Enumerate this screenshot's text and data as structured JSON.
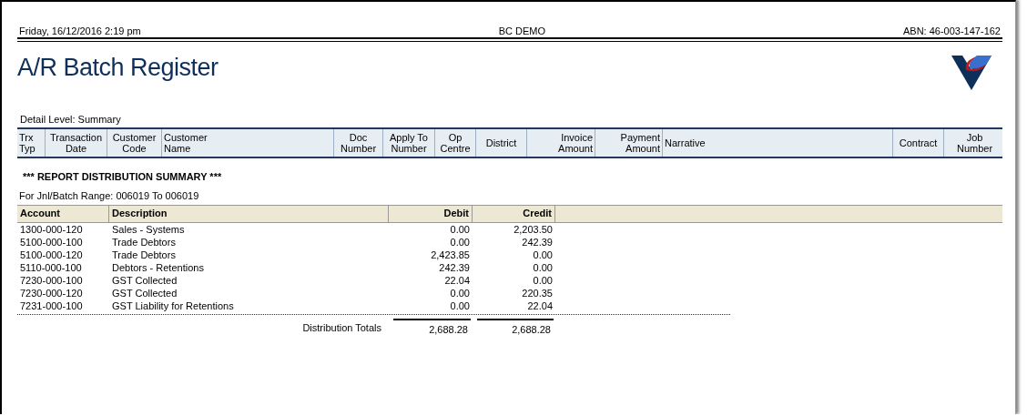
{
  "header": {
    "date": "Friday, 16/12/2016  2:19 pm",
    "company": "BC DEMO",
    "abn": "ABN: 46-003-147-162"
  },
  "title": "A/R Batch Register",
  "detail_level": "Detail Level: Summary",
  "columns": [
    {
      "lines": [
        "Trx",
        "Typ"
      ]
    },
    {
      "lines": [
        "Transaction",
        "Date"
      ]
    },
    {
      "lines": [
        "Customer",
        "Code"
      ]
    },
    {
      "lines": [
        "Customer",
        "Name"
      ]
    },
    {
      "lines": [
        "Doc",
        "Number"
      ]
    },
    {
      "lines": [
        "Apply To",
        "Number"
      ]
    },
    {
      "lines": [
        "Op",
        "Centre"
      ]
    },
    {
      "lines": [
        "District"
      ]
    },
    {
      "lines": [
        "Invoice",
        "Amount"
      ]
    },
    {
      "lines": [
        "Payment",
        "Amount"
      ]
    },
    {
      "lines": [
        "Narrative"
      ]
    },
    {
      "lines": [
        "Contract"
      ]
    },
    {
      "lines": [
        "Job",
        "Number"
      ]
    }
  ],
  "summary": {
    "heading": "*** REPORT DISTRIBUTION SUMMARY ***",
    "range": "For Jnl/Batch Range: 006019 To 006019",
    "table": {
      "columns": [
        "Account",
        "Description",
        "Debit",
        "Credit"
      ],
      "rows": [
        [
          "1300-000-120",
          "Sales - Systems",
          "0.00",
          "2,203.50"
        ],
        [
          "5100-000-100",
          "Trade Debtors",
          "0.00",
          "242.39"
        ],
        [
          "5100-000-120",
          "Trade Debtors",
          "2,423.85",
          "0.00"
        ],
        [
          "5110-000-100",
          "Debtors - Retentions",
          "242.39",
          "0.00"
        ],
        [
          "7230-000-100",
          "GST Collected",
          "22.04",
          "0.00"
        ],
        [
          "7230-000-120",
          "GST Collected",
          "0.00",
          "220.35"
        ],
        [
          "7231-000-100",
          "GST Liability for Retentions",
          "0.00",
          "22.04"
        ]
      ]
    },
    "totals": {
      "label": "Distribution Totals",
      "debit": "2,688.28",
      "credit": "2,688.28"
    }
  }
}
